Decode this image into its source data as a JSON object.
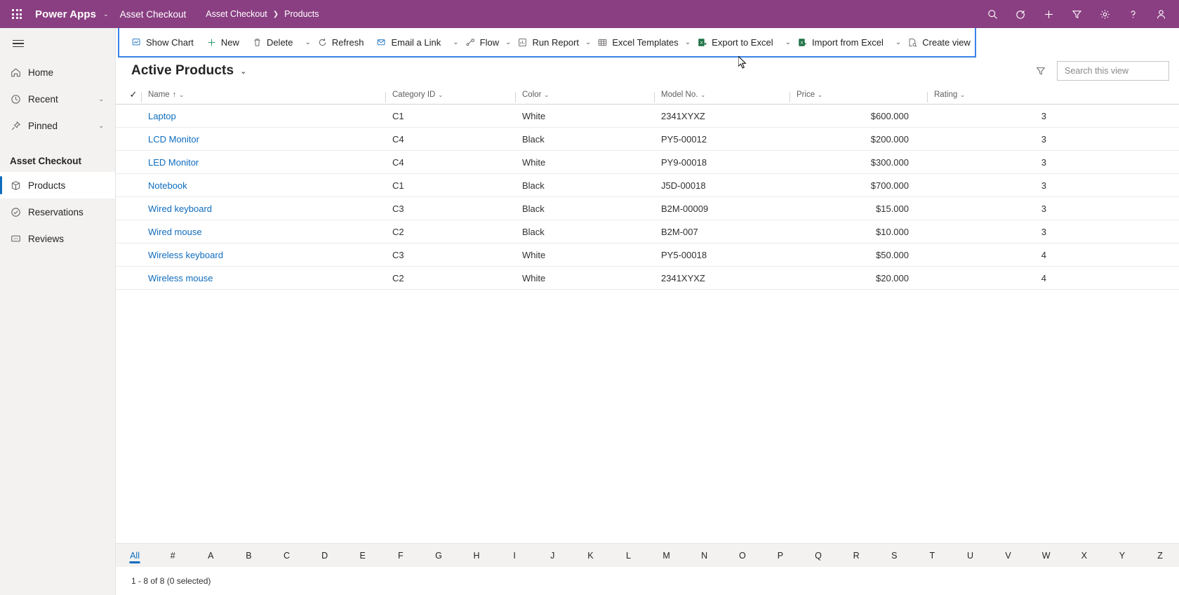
{
  "appbar": {
    "waffle_label": "app-launcher",
    "brand": "Power Apps",
    "app_name": "Asset Checkout",
    "breadcrumb": [
      "Asset Checkout",
      "Products"
    ],
    "breadcrumb_separator": "❯",
    "icons": [
      "search-icon",
      "assistant-icon",
      "add-icon",
      "filter-icon",
      "settings-icon",
      "help-icon",
      "account-icon"
    ],
    "brand_color": "#8A3F82"
  },
  "sidebar": {
    "hamburger_label": "Menu",
    "items": [
      {
        "label": "Home",
        "icon": "home-icon",
        "expandable": false
      },
      {
        "label": "Recent",
        "icon": "clock-icon",
        "expandable": true
      },
      {
        "label": "Pinned",
        "icon": "pin-icon",
        "expandable": true
      }
    ],
    "group_title": "Asset Checkout",
    "group_items": [
      {
        "label": "Products",
        "icon": "box-icon",
        "active": true
      },
      {
        "label": "Reservations",
        "icon": "check-circle-icon",
        "active": false
      },
      {
        "label": "Reviews",
        "icon": "comment-icon",
        "active": false
      }
    ]
  },
  "commandbar": {
    "highlight_color": "#3b82e8",
    "buttons": [
      {
        "label": "Show Chart",
        "icon": "chart-icon",
        "chevron": false,
        "separator_after": false
      },
      {
        "label": "New",
        "icon": "plus-icon",
        "chevron": false,
        "separator_after": false
      },
      {
        "label": "Delete",
        "icon": "trash-icon",
        "chevron": true,
        "separator_after": true
      },
      {
        "label": "Refresh",
        "icon": "refresh-icon",
        "chevron": false,
        "separator_after": false
      },
      {
        "label": "Email a Link",
        "icon": "email-link-icon",
        "chevron": true,
        "separator_after": true
      },
      {
        "label": "Flow",
        "icon": "flow-icon",
        "chevron": true,
        "separator_after": false
      },
      {
        "label": "Run Report",
        "icon": "report-icon",
        "chevron": true,
        "separator_after": false
      },
      {
        "label": "Excel Templates",
        "icon": "excel-template-icon",
        "chevron": true,
        "separator_after": false
      },
      {
        "label": "Export to Excel",
        "icon": "excel-export-icon",
        "chevron": true,
        "separator_after": true
      },
      {
        "label": "Import from Excel",
        "icon": "excel-import-icon",
        "chevron": true,
        "separator_after": true
      },
      {
        "label": "Create view",
        "icon": "create-view-icon",
        "chevron": false,
        "separator_after": false
      }
    ]
  },
  "view": {
    "title": "Active Products",
    "title_chevron": "⌄",
    "filter_icon": "filter-icon",
    "search": {
      "placeholder": "Search this view",
      "value": "",
      "icon": "search-icon"
    }
  },
  "table": {
    "select_all_icon": "checkmark-icon",
    "columns": [
      {
        "key": "name",
        "label": "Name",
        "sorted": true,
        "sort_arrow": "↑",
        "align": "left"
      },
      {
        "key": "cat",
        "label": "Category ID",
        "sorted": false,
        "sort_arrow": "",
        "align": "left"
      },
      {
        "key": "color",
        "label": "Color",
        "sorted": false,
        "sort_arrow": "",
        "align": "left"
      },
      {
        "key": "model",
        "label": "Model No.",
        "sorted": false,
        "sort_arrow": "",
        "align": "left"
      },
      {
        "key": "price",
        "label": "Price",
        "sorted": false,
        "sort_arrow": "",
        "align": "right"
      },
      {
        "key": "rating",
        "label": "Rating",
        "sorted": false,
        "sort_arrow": "",
        "align": "right"
      }
    ],
    "rows": [
      {
        "name": "Laptop",
        "cat": "C1",
        "color": "White",
        "model": "2341XYXZ",
        "price": "$600.000",
        "rating": "3"
      },
      {
        "name": "LCD Monitor",
        "cat": "C4",
        "color": "Black",
        "model": "PY5-00012",
        "price": "$200.000",
        "rating": "3"
      },
      {
        "name": "LED Monitor",
        "cat": "C4",
        "color": "White",
        "model": "PY9-00018",
        "price": "$300.000",
        "rating": "3"
      },
      {
        "name": "Notebook",
        "cat": "C1",
        "color": "Black",
        "model": "J5D-00018",
        "price": "$700.000",
        "rating": "3"
      },
      {
        "name": "Wired keyboard",
        "cat": "C3",
        "color": "Black",
        "model": "B2M-00009",
        "price": "$15.000",
        "rating": "3"
      },
      {
        "name": "Wired mouse",
        "cat": "C2",
        "color": "Black",
        "model": "B2M-007",
        "price": "$10.000",
        "rating": "3"
      },
      {
        "name": "Wireless keyboard",
        "cat": "C3",
        "color": "White",
        "model": "PY5-00018",
        "price": "$50.000",
        "rating": "4"
      },
      {
        "name": "Wireless mouse",
        "cat": "C2",
        "color": "White",
        "model": "2341XYXZ",
        "price": "$20.000",
        "rating": "4"
      }
    ]
  },
  "alphabar": {
    "selected": "All",
    "items": [
      "All",
      "#",
      "A",
      "B",
      "C",
      "D",
      "E",
      "F",
      "G",
      "H",
      "I",
      "J",
      "K",
      "L",
      "M",
      "N",
      "O",
      "P",
      "Q",
      "R",
      "S",
      "T",
      "U",
      "V",
      "W",
      "X",
      "Y",
      "Z"
    ]
  },
  "footer": {
    "status": "1 - 8 of 8 (0 selected)"
  }
}
